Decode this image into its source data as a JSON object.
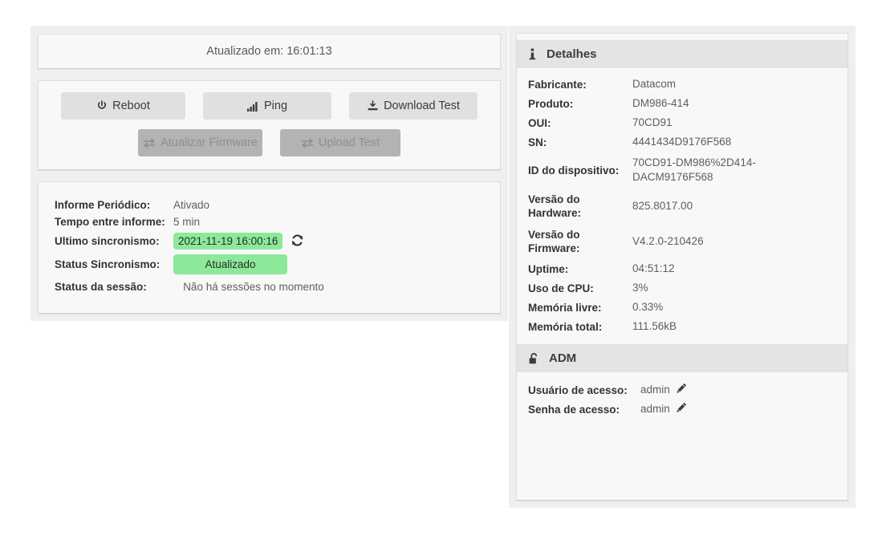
{
  "left": {
    "updated": {
      "text": "Atualizado em: 16:01:13"
    },
    "actions": {
      "row1": [
        {
          "label": "Reboot",
          "icon": "power-icon",
          "name": "reboot-button",
          "disabled": false
        },
        {
          "label": "Ping",
          "icon": "signal-bars-icon",
          "name": "ping-button",
          "disabled": false
        },
        {
          "label": "Download Test",
          "icon": "download-icon",
          "name": "download-test-button",
          "disabled": false
        }
      ],
      "row2": [
        {
          "label": "Atualizar Firmware",
          "icon": "exchange-icon",
          "name": "atualizar-firmware-button",
          "disabled": true
        },
        {
          "label": "Upload Test",
          "icon": "exchange-icon",
          "name": "upload-test-button",
          "disabled": true
        }
      ]
    },
    "info": {
      "informe_periodico_label": "Informe Periódico:",
      "informe_periodico_value": "Ativado",
      "tempo_entre_informe_label": "Tempo entre informe:",
      "tempo_entre_informe_value": "5 min",
      "ultimo_sincronismo_label": "Ultimo sincronismo:",
      "ultimo_sincronismo_value": "2021-11-19 16:00:16",
      "status_sincronismo_label": "Status Sincronismo:",
      "status_sincronismo_value": "Atualizado",
      "status_sessao_label": "Status da sessão:",
      "status_sessao_value": "Não há sessões no momento",
      "refresh_icon": "refresh-icon"
    }
  },
  "right": {
    "details": {
      "header": "Detalhes",
      "header_icon": "info-icon",
      "rows": [
        {
          "label": "Fabricante:",
          "value": "Datacom"
        },
        {
          "label": "Produto:",
          "value": "DM986-414"
        },
        {
          "label": "OUI:",
          "value": "70CD91"
        },
        {
          "label": "SN:",
          "value": "4441434D9176F568"
        },
        {
          "label": "ID do dispositivo:",
          "value": "70CD91-DM986%2D414-DACM9176F568"
        },
        {
          "label": "Versão do Hardware:",
          "value": "825.8017.00"
        },
        {
          "label": "Versão do Firmware:",
          "value": "V4.2.0-210426"
        },
        {
          "label": "Uptime:",
          "value": "04:51:12"
        },
        {
          "label": "Uso de CPU:",
          "value": "3%"
        },
        {
          "label": "Memória livre:",
          "value": "0.33%"
        },
        {
          "label": "Memória total:",
          "value": "111.56kB"
        }
      ]
    },
    "adm": {
      "header": "ADM",
      "header_icon": "unlock-icon",
      "rows": [
        {
          "label": "Usuário de acesso:",
          "value": "admin",
          "icon": "pencil-icon"
        },
        {
          "label": "Senha de acesso:",
          "value": "admin",
          "icon": "pencil-icon"
        }
      ]
    }
  },
  "colors": {
    "badge_green": "#8ce99a",
    "panel_bg": "#f8f8f8",
    "page_bg": "#efefef",
    "header_bg": "#e4e4e4",
    "button_default": "#e0e0e0",
    "button_disabled": "#b3b3b3"
  }
}
